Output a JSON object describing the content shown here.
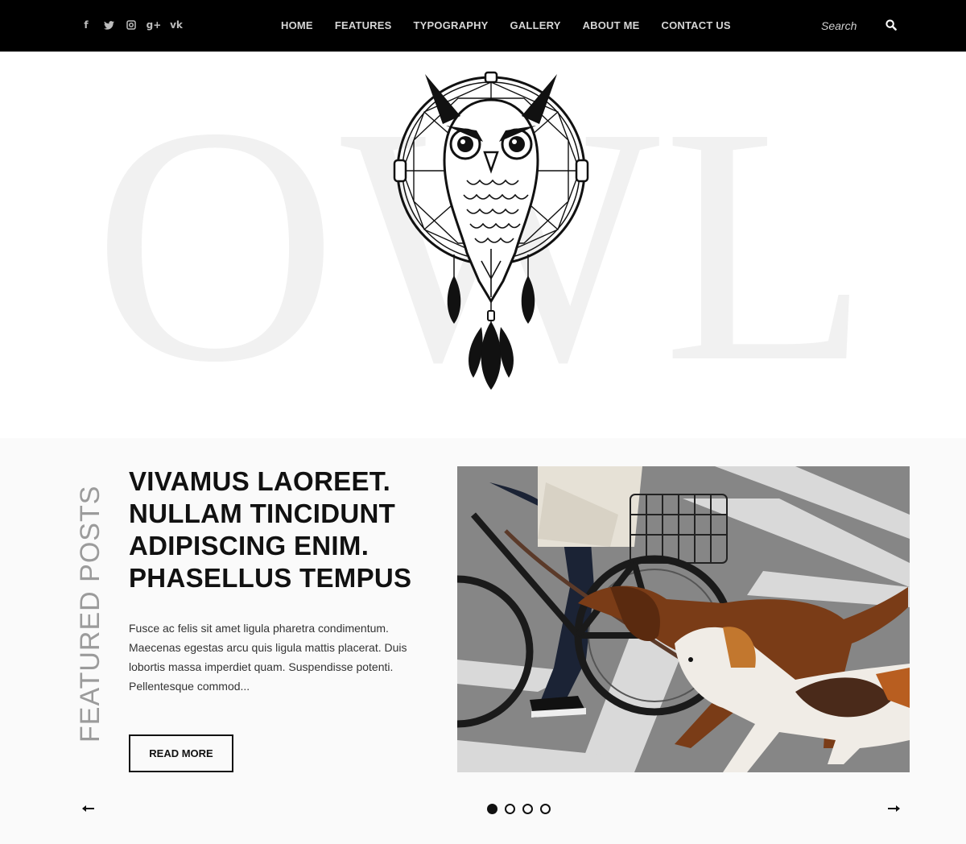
{
  "header": {
    "social_icons": [
      {
        "name": "facebook-icon",
        "glyph": "f"
      },
      {
        "name": "twitter-icon",
        "glyph": "t"
      },
      {
        "name": "instagram-icon",
        "glyph": "◘"
      },
      {
        "name": "google-plus-icon",
        "glyph": "g+"
      },
      {
        "name": "vk-icon",
        "glyph": "vk"
      }
    ],
    "nav": [
      "HOME",
      "FEATURES",
      "TYPOGRAPHY",
      "GALLERY",
      "ABOUT ME",
      "CONTACT US"
    ],
    "search_placeholder": "Search",
    "search_icon": "search-icon"
  },
  "hero": {
    "background_text": "OWL",
    "logo_icon": "owl-dreamcatcher-logo"
  },
  "featured": {
    "section_label": "FEATURED POSTS",
    "title": "VIVAMUS LAOREET. NULLAM TINCIDUNT ADIPISCING ENIM. PHASELLUS TEMPUS",
    "excerpt": "Fusce ac felis sit amet ligula pharetra condimentum. Maecenas egestas arcu quis ligula mattis placerat. Duis lobortis massa imperdiet quam. Suspendisse potenti. Pellentesque commod...",
    "read_more": "READ MORE",
    "prev_icon": "arrow-left-icon",
    "next_icon": "arrow-right-icon",
    "slides_total": 4,
    "active_slide": 1
  },
  "colors": {
    "nav_bg": "#000000",
    "nav_text": "#d6d6d6",
    "section_bg": "#fafafa",
    "hero_letter": "#f1f1f1"
  }
}
